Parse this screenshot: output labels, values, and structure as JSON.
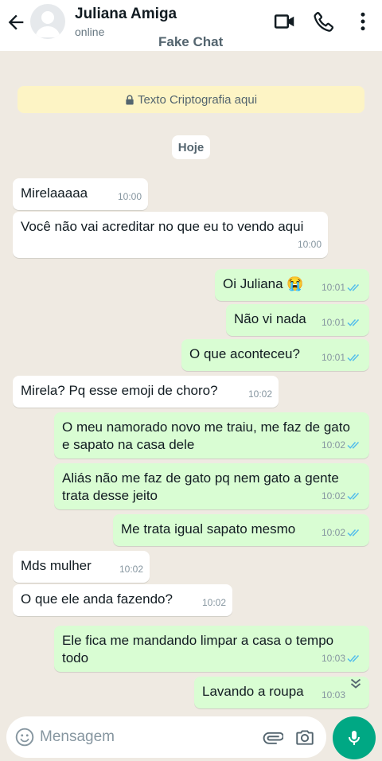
{
  "header": {
    "contact_name": "Juliana Amiga",
    "status": "online",
    "watermark": "Fake Chat",
    "icons": [
      "back-arrow-icon",
      "avatar",
      "video-call-icon",
      "phone-icon",
      "more-vert-icon"
    ]
  },
  "chat": {
    "encryption_notice": "Texto Criptografia aqui",
    "date_label": "Hoje",
    "messages": [
      {
        "dir": "in",
        "text": "Mirelaaaaa",
        "time": "10:00"
      },
      {
        "dir": "in",
        "text": "Você não vai acreditar no que eu to vendo aqui",
        "time": "10:00"
      },
      {
        "dir": "out",
        "text": "Oi Juliana 😭",
        "time": "10:01"
      },
      {
        "dir": "out",
        "text": "Não vi nada",
        "time": "10:01"
      },
      {
        "dir": "out",
        "text": "O que aconteceu?",
        "time": "10:01"
      },
      {
        "dir": "in",
        "text": "Mirela? Pq esse emoji de choro?",
        "time": "10:02"
      },
      {
        "dir": "out",
        "text": "O meu namorado novo me traiu, me faz de gato e sapato na casa dele",
        "time": "10:02"
      },
      {
        "dir": "out",
        "text": "Aliás não me faz de gato pq nem gato a gente trata desse jeito",
        "time": "10:02"
      },
      {
        "dir": "out",
        "text": "Me trata igual sapato mesmo",
        "time": "10:02"
      },
      {
        "dir": "in",
        "text": "Mds mulher",
        "time": "10:02"
      },
      {
        "dir": "in",
        "text": "O que ele anda fazendo?",
        "time": "10:02"
      },
      {
        "dir": "out",
        "text": "Ele fica me mandando limpar a casa o tempo todo",
        "time": "10:03"
      },
      {
        "dir": "out",
        "text": "Lavando a roupa",
        "time": "10:03"
      }
    ]
  },
  "input": {
    "placeholder": "Mensagem"
  },
  "colors": {
    "accent": "#00a884",
    "incoming_bubble": "#ffffff",
    "outgoing_bubble": "#d9fdd3",
    "read_ticks": "#53bdeb",
    "background": "#efeae2"
  }
}
